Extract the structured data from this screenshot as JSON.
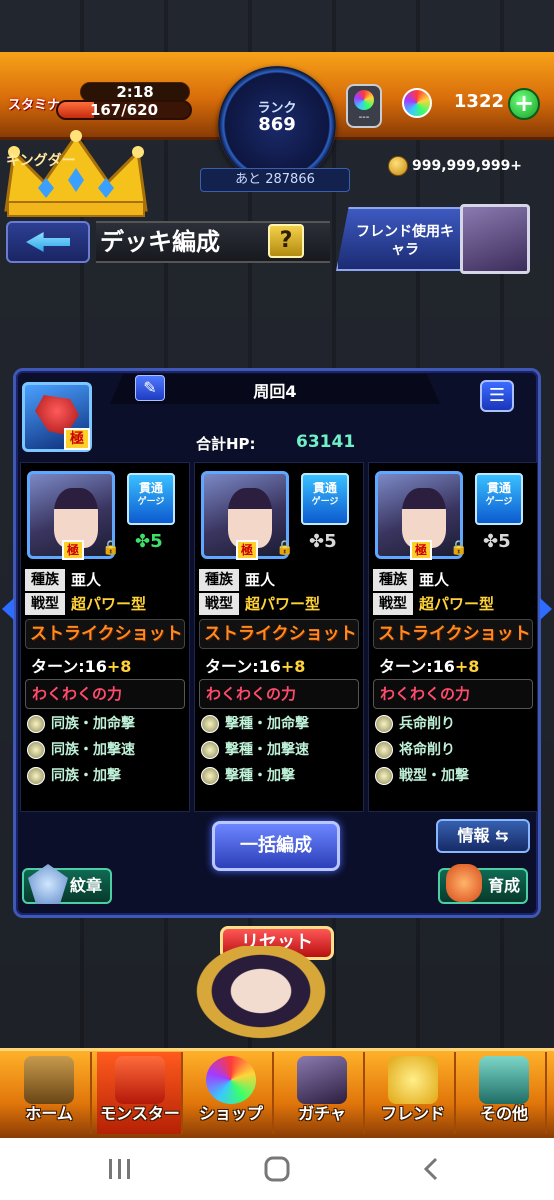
{
  "header": {
    "stamina_label": "スタミナ",
    "stamina_time": "2:18",
    "stamina_value": "167/620",
    "stamina_fraction": 0.27,
    "rank_label": "ランク",
    "rank_value": "869",
    "rank_next": "あと 287866",
    "gem_slot_value": "---",
    "orb_count": "1322",
    "orb_add": "+",
    "gold_value": "999,999,999+",
    "kings_text": "キングダー"
  },
  "title_bar": {
    "title": "デッキ編成",
    "help": "?",
    "friend_button": "フレンド使用キャラ"
  },
  "deck": {
    "name": "周回4",
    "edit_icon": "✎",
    "list_icon": "☰",
    "leader_tag": "極",
    "total_hp_label": "合計HP:",
    "total_hp_value": "63141",
    "slots": [
      {
        "pierce_top": "貫通",
        "pierce_sub": "ゲージ",
        "badge": "極",
        "clover": "✤5",
        "clover_color": "#3ee06a",
        "race_label": "種族",
        "race": "亜人",
        "type_label": "戦型",
        "type": "超パワー型",
        "strike": "ストライクショット",
        "turn": "ターン:16",
        "turn_plus": "+8",
        "gauge": "わくわくの力",
        "abilities": [
          "同族・加命撃",
          "同族・加撃速",
          "同族・加撃"
        ]
      },
      {
        "pierce_top": "貫通",
        "pierce_sub": "ゲージ",
        "badge": "極",
        "clover": "✤5",
        "clover_color": "#d8d8d8",
        "race_label": "種族",
        "race": "亜人",
        "type_label": "戦型",
        "type": "超パワー型",
        "strike": "ストライクショット",
        "turn": "ターン:16",
        "turn_plus": "+8",
        "gauge": "わくわくの力",
        "abilities": [
          "撃種・加命撃",
          "撃種・加撃速",
          "撃種・加撃"
        ]
      },
      {
        "pierce_top": "貫通",
        "pierce_sub": "ゲージ",
        "badge": "極",
        "clover": "✤5",
        "clover_color": "#d8d8d8",
        "race_label": "種族",
        "race": "亜人",
        "type_label": "戦型",
        "type": "超パワー型",
        "strike": "ストライクショット",
        "turn": "ターン:16",
        "turn_plus": "+8",
        "gauge": "わくわくの力",
        "abilities": [
          "兵命削り",
          "将命削り",
          "戦型・加撃"
        ]
      }
    ],
    "bulk_button": "一括編成",
    "info_button": "情報 ⇆",
    "crest_button": "紋章",
    "grow_button": "育成"
  },
  "reset_button": "リセット",
  "nav": {
    "items": [
      {
        "label": "ホーム",
        "icon": "home-icon"
      },
      {
        "label": "モンスター",
        "icon": "monster-icon"
      },
      {
        "label": "ショップ",
        "icon": "shop-orb-icon"
      },
      {
        "label": "ガチャ",
        "icon": "gacha-icon"
      },
      {
        "label": "フレンド",
        "icon": "friend-icon"
      },
      {
        "label": "その他",
        "icon": "other-icon"
      }
    ]
  },
  "colors": {
    "accent_orange": "#e1760a",
    "panel_blue": "#3f57b5",
    "hp_green": "#6ff0c6",
    "strike_orange": "#ff8a1e",
    "gauge_pink": "#ff4b6b"
  }
}
